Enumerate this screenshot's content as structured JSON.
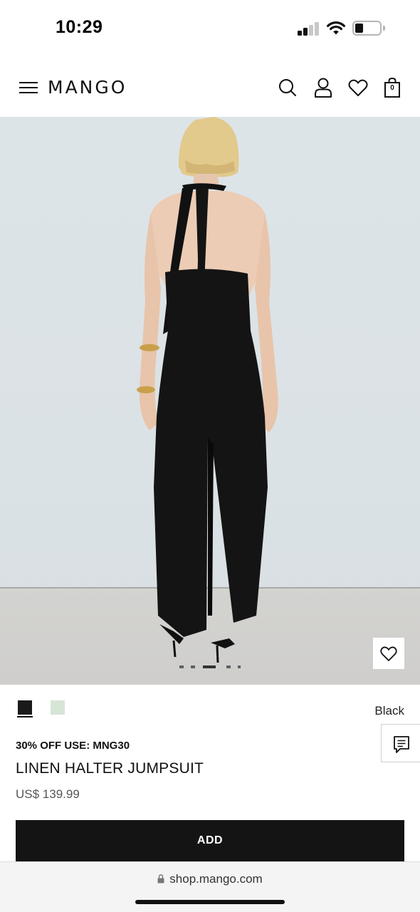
{
  "status_bar": {
    "time": "10:29"
  },
  "header": {
    "brand": "MANGO",
    "bag_count": "0"
  },
  "gallery": {
    "image_description_icon": "product-photo"
  },
  "product": {
    "color_name": "Black",
    "swatches": [
      {
        "name": "Black",
        "hex": "#1a1a1a"
      },
      {
        "name": "Mint",
        "hex": "#d7e5d7"
      }
    ],
    "promo": "30% OFF USE: MNG30",
    "name": "LINEN HALTER JUMPSUIT",
    "price": "US$ 139.99",
    "add_label": "ADD"
  },
  "browser": {
    "url": "shop.mango.com"
  },
  "colors": {
    "button_bg": "#141414",
    "hero_bg": "#dde4e8"
  }
}
